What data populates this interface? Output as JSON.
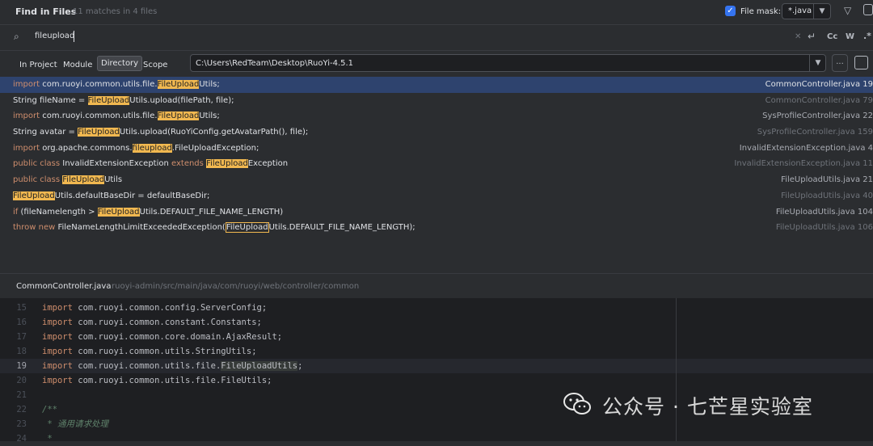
{
  "header": {
    "title": "Find in Files",
    "match_count": "11 matches in 4 files",
    "file_mask_label": "File mask:",
    "file_mask_value": "*.java"
  },
  "search": {
    "query": "fileupload",
    "toggles": {
      "case": "Cc",
      "word": "W",
      "regex": ".*"
    }
  },
  "scope": {
    "tabs": [
      "In Project",
      "Module",
      "Directory",
      "Scope"
    ],
    "selected": "Directory",
    "directory": "C:\\Users\\RedTeam\\Desktop\\RuoYi-4.5.1",
    "browse_label": "..."
  },
  "results": [
    {
      "before_kw": "",
      "kw": "import",
      "pre": " com.ruoyi.common.utils.file.",
      "match": "FileUpload",
      "post": "Utils;",
      "file": "CommonController.java 19",
      "selected": true,
      "boxed": false
    },
    {
      "before_kw": "",
      "kw": "",
      "pre": "String fileName = ",
      "match": "FileUpload",
      "post": "Utils.upload(filePath, file);",
      "file": "CommonController.java 79",
      "selected": false,
      "boxed": false
    },
    {
      "before_kw": "",
      "kw": "import",
      "pre": " com.ruoyi.common.utils.file.",
      "match": "FileUpload",
      "post": "Utils;",
      "file": "SysProfileController.java 22",
      "selected": false,
      "boxed": false
    },
    {
      "before_kw": "",
      "kw": "",
      "pre": "String avatar = ",
      "match": "FileUpload",
      "post": "Utils.upload(RuoYiConfig.getAvatarPath(), file);",
      "file": "SysProfileController.java 159",
      "selected": false,
      "boxed": false
    },
    {
      "before_kw": "",
      "kw": "import",
      "pre": " org.apache.commons.",
      "match": "fileupload",
      "post": ".FileUploadException;",
      "file": "InvalidExtensionException.java 4",
      "selected": false,
      "boxed": false
    },
    {
      "before_kw": "",
      "kw": "public class",
      "pre": " InvalidExtensionException ",
      "kw2": "extends",
      "pre2": " ",
      "match": "FileUpload",
      "post": "Exception",
      "file": "InvalidExtensionException.java 11",
      "selected": false,
      "boxed": false
    },
    {
      "before_kw": "",
      "kw": "public class",
      "pre": " ",
      "match": "FileUpload",
      "post": "Utils",
      "file": "FileUploadUtils.java 21",
      "selected": false,
      "boxed": false
    },
    {
      "before_kw": "",
      "kw": "",
      "pre": "",
      "match": "FileUpload",
      "post": "Utils.defaultBaseDir = defaultBaseDir;",
      "file": "FileUploadUtils.java 40",
      "selected": false,
      "boxed": false
    },
    {
      "before_kw": "",
      "kw": "if",
      "pre": " (fileNamelength > ",
      "match": "FileUpload",
      "post": "Utils.DEFAULT_FILE_NAME_LENGTH)",
      "file": "FileUploadUtils.java 104",
      "selected": false,
      "boxed": false
    },
    {
      "before_kw": "",
      "kw": "throw new",
      "pre": " FileNameLengthLimitExceededException(",
      "match": "FileUpload",
      "post": "Utils.DEFAULT_FILE_NAME_LENGTH);",
      "file": "FileUploadUtils.java 106",
      "selected": false,
      "boxed": true
    }
  ],
  "preview": {
    "file": "CommonController.java",
    "path": "ruoyi-admin/src/main/java/com/ruoyi/web/controller/common"
  },
  "editor": {
    "current_line": 19,
    "lines": [
      {
        "n": "15",
        "kw": "import",
        "rest": " com.ruoyi.common.config.ServerConfig;"
      },
      {
        "n": "16",
        "kw": "import",
        "rest": " com.ruoyi.common.constant.Constants;"
      },
      {
        "n": "17",
        "kw": "import",
        "rest": " com.ruoyi.common.core.domain.AjaxResult;"
      },
      {
        "n": "18",
        "kw": "import",
        "rest": " com.ruoyi.common.utils.StringUtils;"
      },
      {
        "n": "19",
        "kw": "import",
        "rest": " com.ruoyi.common.utils.file.",
        "hl": "FileUploadUtils",
        "tail": ";"
      },
      {
        "n": "20",
        "kw": "import",
        "rest": " com.ruoyi.common.utils.file.FileUtils;"
      },
      {
        "n": "21",
        "kw": "",
        "rest": ""
      },
      {
        "n": "22",
        "cmt": "/**"
      },
      {
        "n": "23",
        "cmt": " * 通用请求处理"
      },
      {
        "n": "24",
        "cmt": " *"
      }
    ]
  },
  "watermark": "公众号 · 七芒星实验室"
}
